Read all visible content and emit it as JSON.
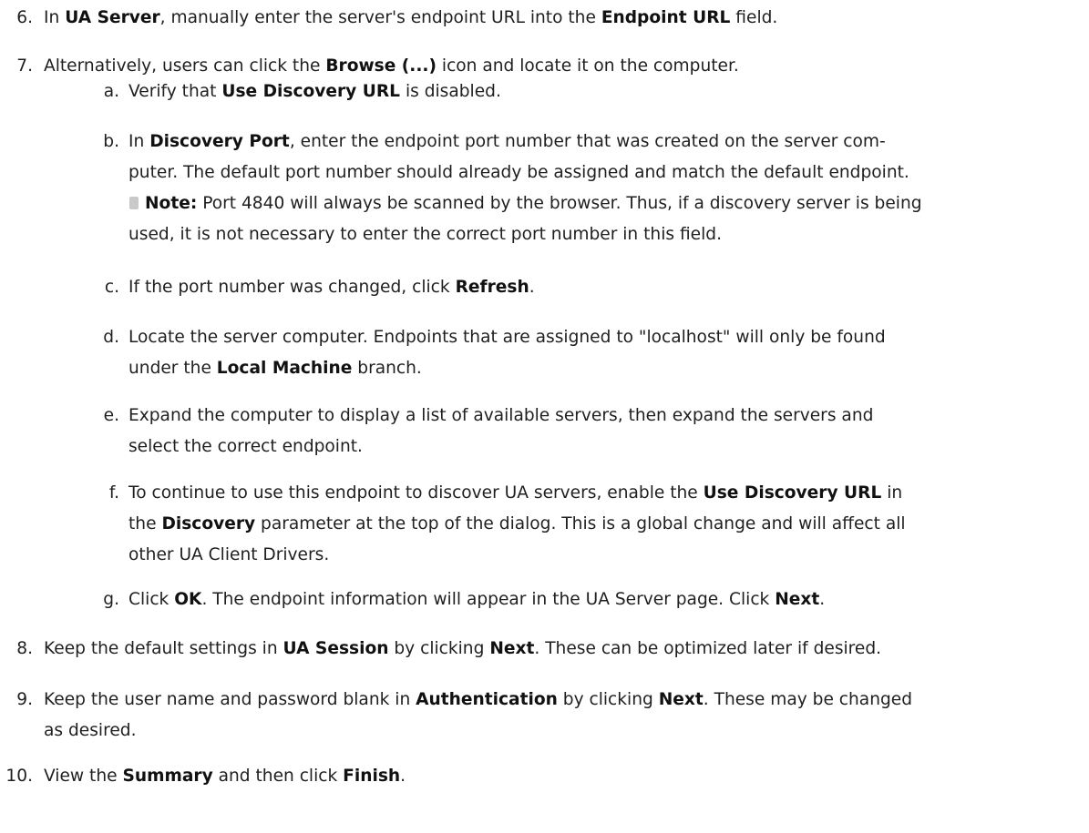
{
  "items": [
    {
      "num": "6.",
      "segments": [
        {
          "t": "In "
        },
        {
          "t": "UA Server",
          "b": true
        },
        {
          "t": ", manually enter the server's endpoint URL into the "
        },
        {
          "t": "Endpoint URL",
          "b": true
        },
        {
          "t": " field."
        }
      ]
    },
    {
      "num": "7.",
      "segments": [
        {
          "t": "Alternatively, users can click the "
        },
        {
          "t": "Browse (...)",
          "b": true
        },
        {
          "t": " icon and locate it on the computer."
        }
      ],
      "subitems": [
        {
          "num": "a.",
          "lines": [
            [
              {
                "t": "Verify that "
              },
              {
                "t": "Use Discovery URL",
                "b": true
              },
              {
                "t": " is disabled."
              }
            ]
          ]
        },
        {
          "num": "b.",
          "lines": [
            [
              {
                "t": "In "
              },
              {
                "t": "Discovery Port",
                "b": true
              },
              {
                "t": ", enter the endpoint port number that was created on the server com-"
              }
            ],
            [
              {
                "t": "puter. The default port number should already be assigned and match the default endpoint."
              }
            ],
            [
              {
                "icon": "note-icon"
              },
              {
                "t": "Note:",
                "b": true
              },
              {
                "t": " Port 4840 will always be scanned by the browser. Thus, if a discovery server is being"
              }
            ],
            [
              {
                "t": "used, it is not necessary to enter the correct port number in this field."
              }
            ]
          ]
        },
        {
          "num": "c.",
          "lines": [
            [
              {
                "t": "If the port number was changed, click "
              },
              {
                "t": "Refresh",
                "b": true
              },
              {
                "t": "."
              }
            ]
          ]
        },
        {
          "num": "d.",
          "lines": [
            [
              {
                "t": "Locate the server computer. Endpoints that are assigned to \"localhost\" will only be found"
              }
            ],
            [
              {
                "t": "under the "
              },
              {
                "t": "Local Machine",
                "b": true
              },
              {
                "t": " branch."
              }
            ]
          ]
        },
        {
          "num": "e.",
          "lines": [
            [
              {
                "t": "Expand the computer to display a list of available servers, then expand the servers and"
              }
            ],
            [
              {
                "t": "select the correct endpoint."
              }
            ]
          ]
        },
        {
          "num": "f.",
          "lines": [
            [
              {
                "t": "To continue to use this endpoint to discover UA servers, enable the "
              },
              {
                "t": "Use Discovery URL",
                "b": true
              },
              {
                "t": " in"
              }
            ],
            [
              {
                "t": "the "
              },
              {
                "t": "Discovery",
                "b": true
              },
              {
                "t": " parameter at the top of the dialog. This is a global change and will affect all"
              }
            ],
            [
              {
                "t": "other UA Client Drivers."
              }
            ]
          ]
        },
        {
          "num": "g.",
          "lines": [
            [
              {
                "t": "Click "
              },
              {
                "t": "OK",
                "b": true
              },
              {
                "t": ". The endpoint information will appear in the UA Server page. Click "
              },
              {
                "t": "Next",
                "b": true
              },
              {
                "t": "."
              }
            ]
          ]
        }
      ]
    },
    {
      "num": "8.",
      "segments": [
        {
          "t": "Keep the default settings in "
        },
        {
          "t": "UA Session",
          "b": true
        },
        {
          "t": " by clicking "
        },
        {
          "t": "Next",
          "b": true
        },
        {
          "t": ". These can be optimized later if desired."
        }
      ]
    },
    {
      "num": "9.",
      "lines": [
        [
          {
            "t": "Keep the user name and password blank in "
          },
          {
            "t": "Authentication",
            "b": true
          },
          {
            "t": " by clicking "
          },
          {
            "t": "Next",
            "b": true
          },
          {
            "t": ". These may be changed"
          }
        ],
        [
          {
            "t": "as desired."
          }
        ]
      ]
    },
    {
      "num": "10.",
      "segments": [
        {
          "t": "View the "
        },
        {
          "t": "Summary",
          "b": true
        },
        {
          "t": " and then click "
        },
        {
          "t": "Finish",
          "b": true
        },
        {
          "t": "."
        }
      ]
    }
  ]
}
